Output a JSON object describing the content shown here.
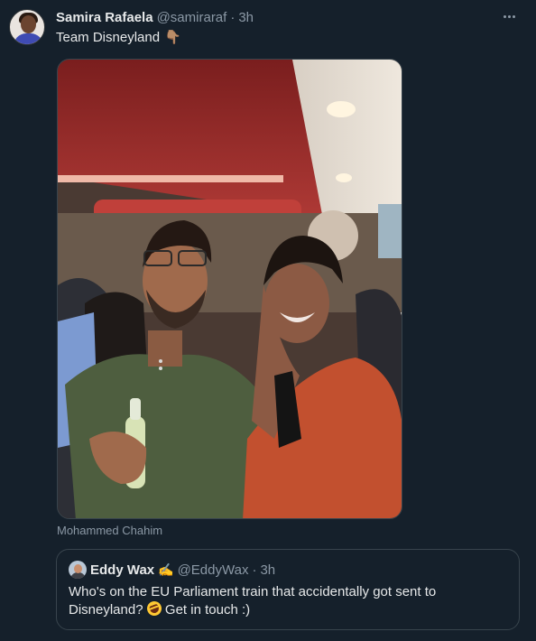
{
  "tweet": {
    "author_name": "Samira Rafaela",
    "author_handle": "@samiraraf",
    "separator": "·",
    "time": "3h",
    "text": "Team Disneyland",
    "text_emoji": "👇🏽",
    "more_icon": "more-horizontal-icon",
    "photo_caption": "Mohammed Chahim"
  },
  "quote": {
    "author_name": "Eddy Wax",
    "author_emoji": "✍",
    "author_handle": "@EddyWax",
    "separator": "·",
    "time": "3h",
    "text_before": "Who's on the EU Parliament train that accidentally got sent to Disneyland?",
    "emoji_icon": "rolling-on-floor-laughing-icon",
    "text_after": "Get in touch :)"
  },
  "colors": {
    "background": "#15202b",
    "primary_text": "#e7e9ea",
    "secondary_text": "#8b98a5",
    "border": "#38444d"
  }
}
